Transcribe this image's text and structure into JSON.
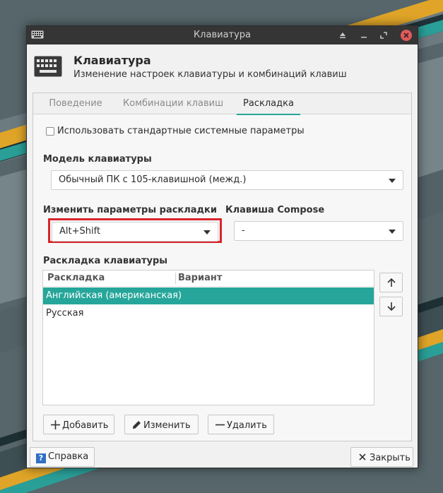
{
  "window": {
    "title": "Клавиатура"
  },
  "header": {
    "title": "Клавиатура",
    "subtitle": "Изменение настроек клавиатуры и комбинаций клавиш"
  },
  "tabs": [
    {
      "label": "Поведение",
      "active": false
    },
    {
      "label": "Комбинации клавиш",
      "active": false
    },
    {
      "label": "Раскладка",
      "active": true
    }
  ],
  "layout_tab": {
    "use_system_defaults": {
      "label": "Использовать стандартные системные параметры",
      "checked": false
    },
    "keyboard_model": {
      "label": "Модель клавиатуры",
      "value": "Обычный ПК с 105-клавишной (межд.)"
    },
    "change_layout_option": {
      "label": "Изменить параметры раскладки",
      "value": "Alt+Shift"
    },
    "compose_key": {
      "label": "Клавиша Compose",
      "value": "-"
    },
    "layouts": {
      "label": "Раскладка клавиатуры",
      "columns": [
        "Раскладка",
        "Вариант"
      ],
      "rows": [
        {
          "layout": "Английская (американская)",
          "variant": "",
          "selected": true
        },
        {
          "layout": "Русская",
          "variant": "",
          "selected": false
        }
      ]
    },
    "buttons": {
      "add": "Добавить",
      "edit": "Изменить",
      "remove": "Удалить"
    }
  },
  "footer": {
    "help": "Справка",
    "close": "Закрыть"
  },
  "colors": {
    "accent": "#26a69a",
    "highlight_box": "#d9242a",
    "titlebar": "#353535"
  }
}
